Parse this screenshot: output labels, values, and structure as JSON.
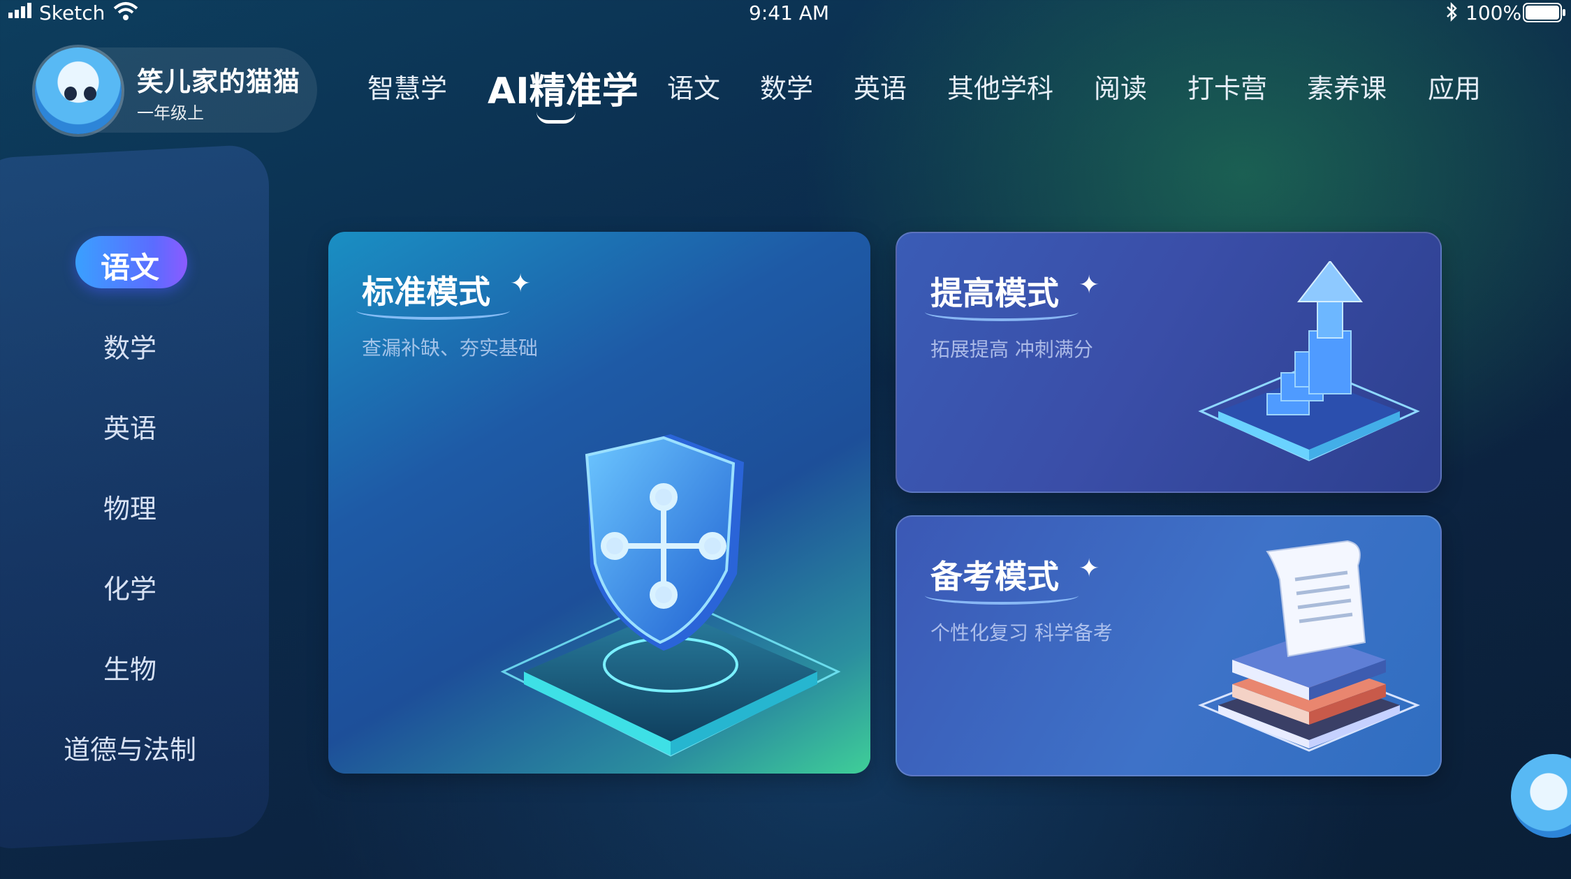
{
  "status_bar": {
    "carrier": "Sketch",
    "time": "9:41 AM",
    "battery": "100%"
  },
  "user": {
    "name": "笑儿家的猫猫",
    "grade": "一年级上"
  },
  "top_nav": [
    {
      "label": "智慧学"
    },
    {
      "label": "AI精准学",
      "active": true
    },
    {
      "label": "语文"
    },
    {
      "label": "数学"
    },
    {
      "label": "英语"
    },
    {
      "label": "其他学科"
    },
    {
      "label": "阅读"
    },
    {
      "label": "打卡营"
    },
    {
      "label": "素养课"
    },
    {
      "label": "应用"
    }
  ],
  "sidebar": {
    "items": [
      {
        "label": "语文",
        "active": true
      },
      {
        "label": "数学"
      },
      {
        "label": "英语"
      },
      {
        "label": "物理"
      },
      {
        "label": "化学"
      },
      {
        "label": "生物"
      },
      {
        "label": "道德与法制"
      }
    ]
  },
  "modes": {
    "standard": {
      "title": "标准模式",
      "subtitle": "查漏补缺、夯实基础",
      "icon": "shield-icon"
    },
    "improve": {
      "title": "提高模式",
      "subtitle": "拓展提高 冲刺满分",
      "icon": "stairs-arrow-icon"
    },
    "exam": {
      "title": "备考模式",
      "subtitle": "个性化复习 科学备考",
      "icon": "books-scroll-icon"
    }
  },
  "sparkle_glyph": "✦",
  "colors": {
    "accent": "#5b6cff",
    "card_standard": "#1e5aa6",
    "card_improve": "#3a4ea8",
    "card_exam": "#3e72c8"
  }
}
